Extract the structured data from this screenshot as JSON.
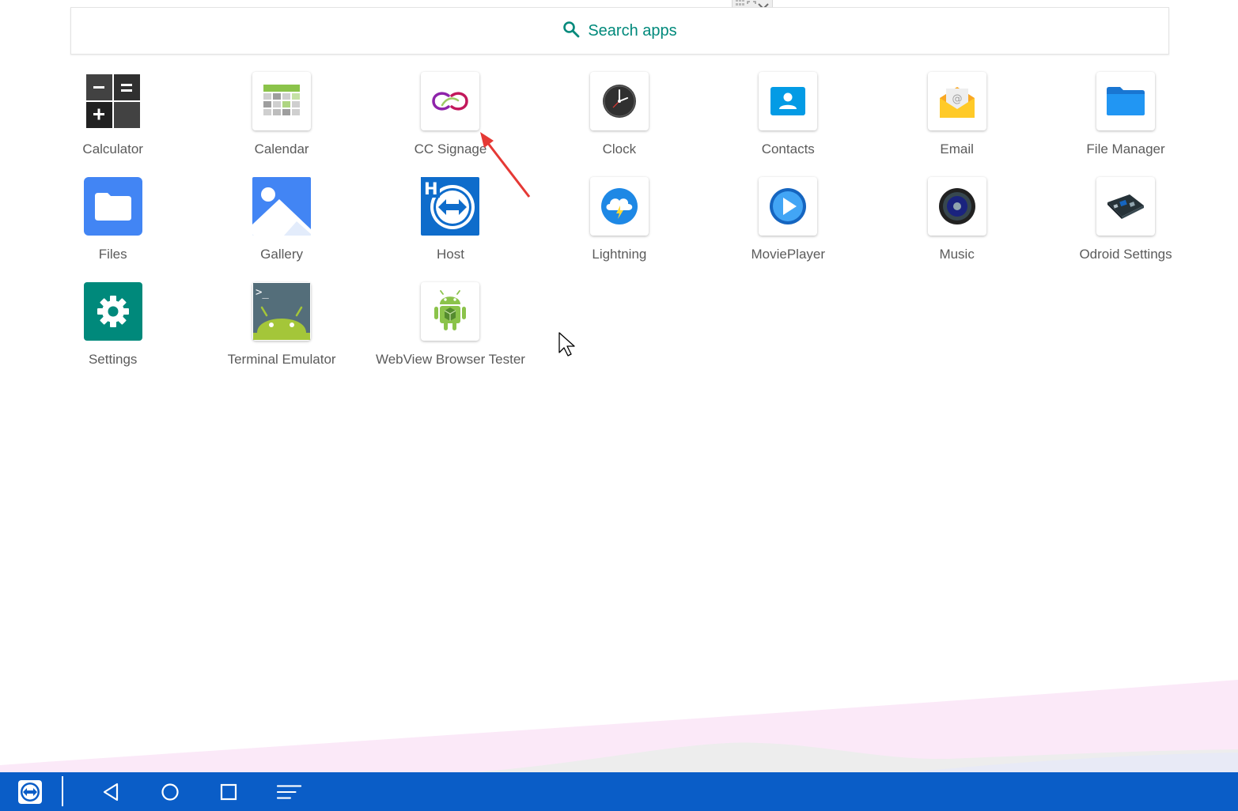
{
  "search": {
    "label": "Search apps"
  },
  "apps": [
    {
      "label": "Calculator",
      "icon": "calculator-icon"
    },
    {
      "label": "Calendar",
      "icon": "calendar-icon"
    },
    {
      "label": "CC Signage",
      "icon": "cc-signage-icon"
    },
    {
      "label": "Clock",
      "icon": "clock-icon"
    },
    {
      "label": "Contacts",
      "icon": "contacts-icon"
    },
    {
      "label": "Email",
      "icon": "email-icon"
    },
    {
      "label": "File Manager",
      "icon": "folder-icon"
    },
    {
      "label": "Files",
      "icon": "files-icon"
    },
    {
      "label": "Gallery",
      "icon": "gallery-icon"
    },
    {
      "label": "Host",
      "icon": "teamviewer-host-icon"
    },
    {
      "label": "Lightning",
      "icon": "lightning-icon"
    },
    {
      "label": "MoviePlayer",
      "icon": "play-icon"
    },
    {
      "label": "Music",
      "icon": "speaker-icon"
    },
    {
      "label": "Odroid Settings",
      "icon": "circuit-board-icon"
    },
    {
      "label": "Settings",
      "icon": "gear-icon"
    },
    {
      "label": "Terminal Emulator",
      "icon": "android-terminal-icon"
    },
    {
      "label": "WebView Browser Tester",
      "icon": "android-webview-icon"
    }
  ],
  "navbar": {
    "color": "#0a5dc7",
    "buttons": [
      "teamviewer-icon",
      "back-icon",
      "home-icon",
      "recents-icon",
      "menu-icon"
    ]
  },
  "colors": {
    "accent": "#00897b",
    "annotation_arrow": "#e53935"
  }
}
